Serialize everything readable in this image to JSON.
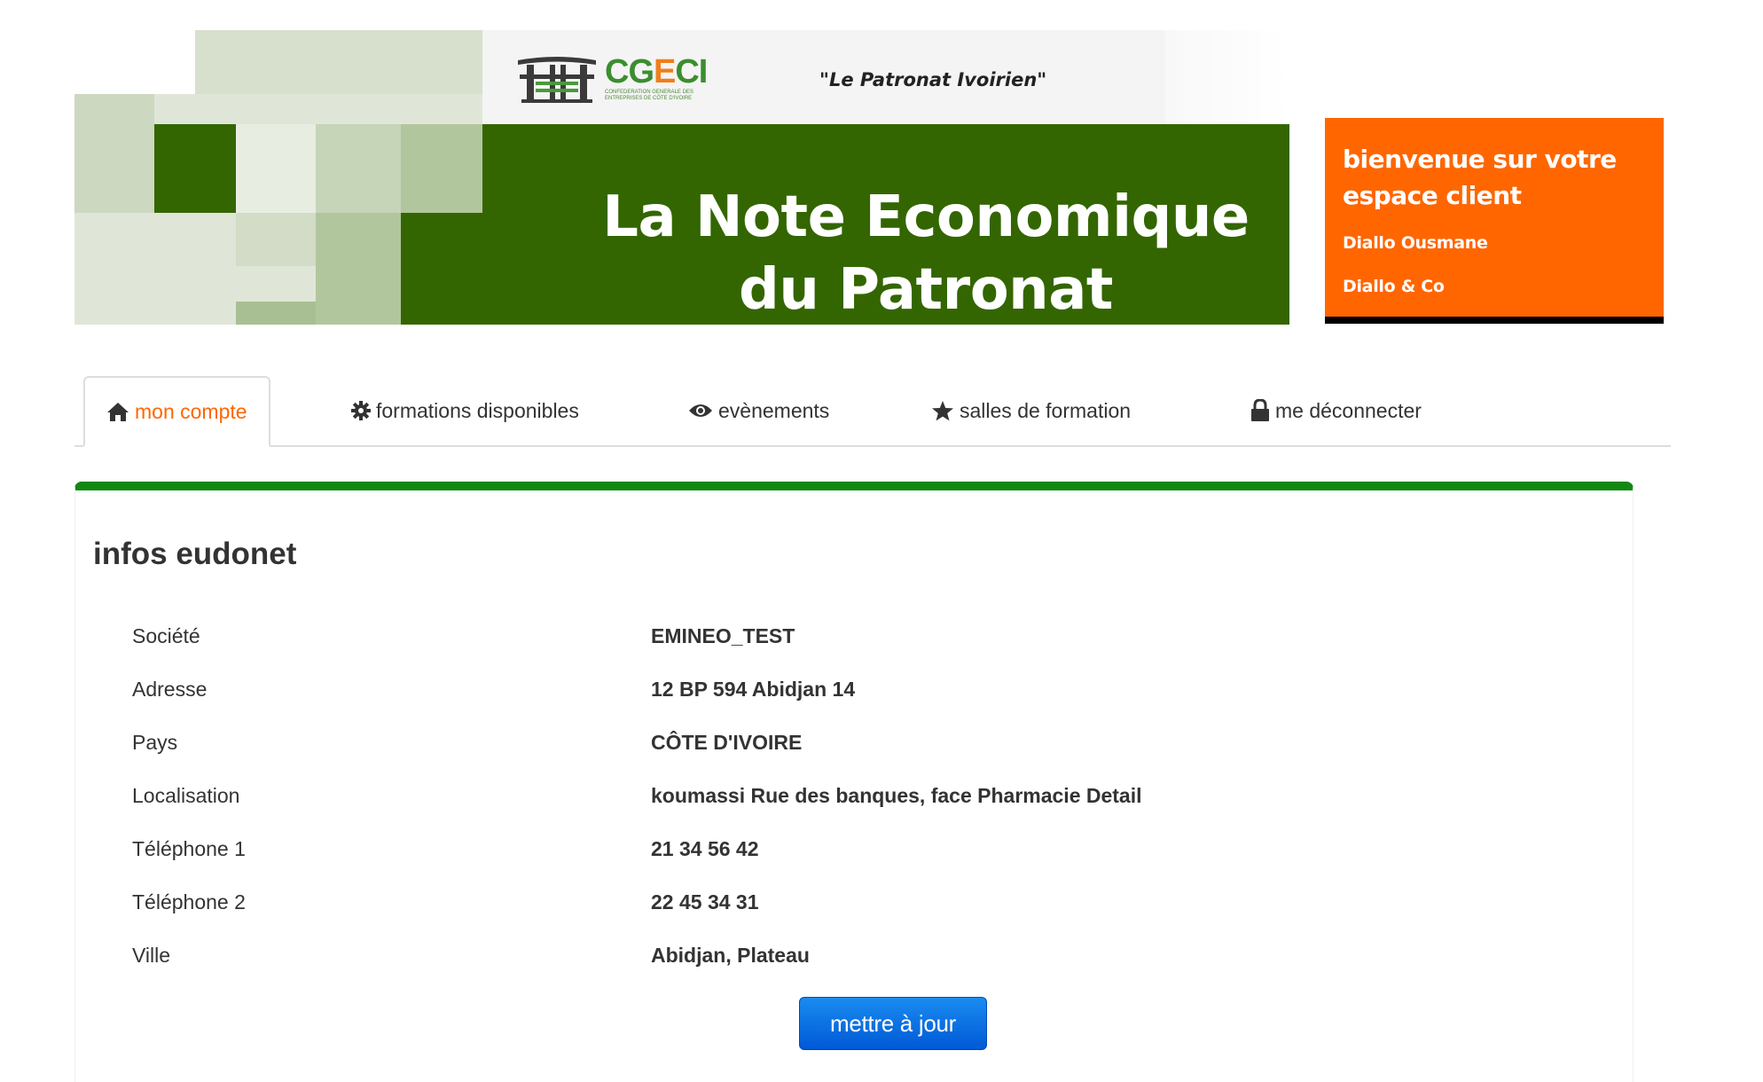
{
  "banner": {
    "logo_text_main": "CG",
    "logo_text_accent": "E",
    "logo_text_end": "CI",
    "logo_subtext": "CONFEDERATION GENERALE DES ENTREPRISES DE CÔTE D'IVOIRE",
    "tagline": "\"Le Patronat Ivoirien\"",
    "title_line1": "La Note Economique",
    "title_line2": "du Patronat"
  },
  "welcome": {
    "title": "bienvenue sur votre espace client",
    "user_name": "Diallo Ousmane",
    "company": "Diallo & Co"
  },
  "tabs": [
    {
      "label": "mon compte",
      "icon": "home-icon",
      "active": true
    },
    {
      "label": "formations disponibles",
      "icon": "gear-icon",
      "active": false
    },
    {
      "label": "evènements",
      "icon": "eye-icon",
      "active": false
    },
    {
      "label": "salles de formation",
      "icon": "star-icon",
      "active": false
    },
    {
      "label": "me déconnecter",
      "icon": "lock-icon",
      "active": false
    }
  ],
  "panel": {
    "title": "infos eudonet",
    "rows": [
      {
        "label": "Société",
        "value": "EMINEO_TEST"
      },
      {
        "label": "Adresse",
        "value": "12 BP 594 Abidjan 14"
      },
      {
        "label": "Pays",
        "value": "CÔTE D'IVOIRE"
      },
      {
        "label": "Localisation",
        "value": "koumassi Rue des banques, face Pharmacie Detail"
      },
      {
        "label": "Téléphone 1",
        "value": "21 34 56 42"
      },
      {
        "label": "Téléphone 2",
        "value": "22 45 34 31"
      },
      {
        "label": "Ville",
        "value": "Abidjan, Plateau"
      }
    ],
    "update_button": "mettre à jour"
  },
  "colors": {
    "accent_orange": "#ff6600",
    "banner_green": "#336600",
    "panel_green": "#118811",
    "button_blue": "#0a6fe6"
  }
}
